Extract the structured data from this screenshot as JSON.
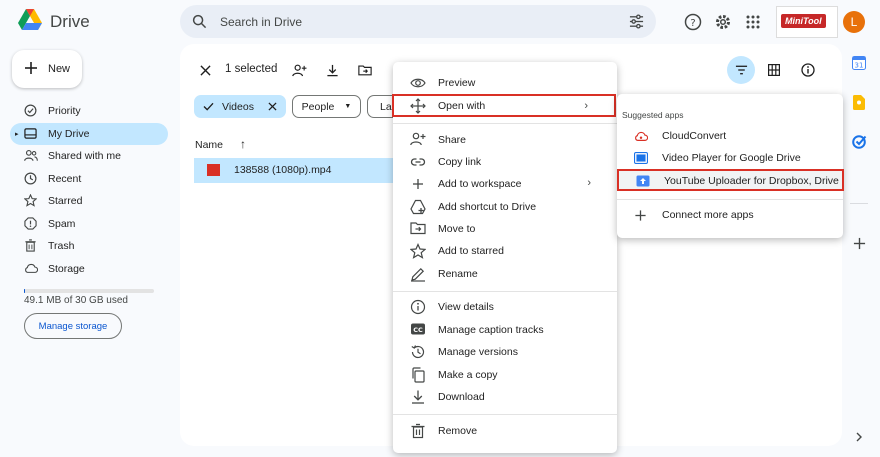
{
  "header": {
    "app_name": "Drive",
    "search_placeholder": "Search in Drive",
    "brand_badge": "MiniTool",
    "avatar_initial": "L"
  },
  "sidebar": {
    "new_label": "New",
    "items": [
      {
        "label": "Priority",
        "icon": "priority-icon"
      },
      {
        "label": "My Drive",
        "icon": "my-drive-icon",
        "active": true
      },
      {
        "label": "Shared with me",
        "icon": "shared-icon"
      },
      {
        "label": "Recent",
        "icon": "clock-icon"
      },
      {
        "label": "Starred",
        "icon": "star-icon"
      },
      {
        "label": "Spam",
        "icon": "spam-icon"
      },
      {
        "label": "Trash",
        "icon": "trash-icon"
      },
      {
        "label": "Storage",
        "icon": "cloud-icon"
      }
    ],
    "storage_text": "49.1 MB of 30 GB used",
    "storage_fraction": 0.0016,
    "manage_storage": "Manage storage"
  },
  "toolbar": {
    "selected_text": "1 selected"
  },
  "filters": {
    "videos": "Videos",
    "people": "People",
    "last_modified_partial": "La"
  },
  "list": {
    "name_header": "Name",
    "files": [
      {
        "name": "138588 (1080p).mp4"
      }
    ]
  },
  "context_menu": {
    "items": [
      "Preview",
      "Open with",
      "Share",
      "Copy link",
      "Add to workspace",
      "Add shortcut to Drive",
      "Move to",
      "Add to starred",
      "Rename",
      "View details",
      "Manage caption tracks",
      "Manage versions",
      "Make a copy",
      "Download",
      "Remove"
    ]
  },
  "submenu": {
    "caption": "Suggested apps",
    "apps": [
      "CloudConvert",
      "Video Player for Google Drive",
      "YouTube Uploader for Dropbox, Drive"
    ],
    "connect": "Connect more apps"
  },
  "colors": {
    "accent": "#c2e7ff",
    "highlight_border": "#d93025",
    "brand_blue": "#0b57d0"
  }
}
